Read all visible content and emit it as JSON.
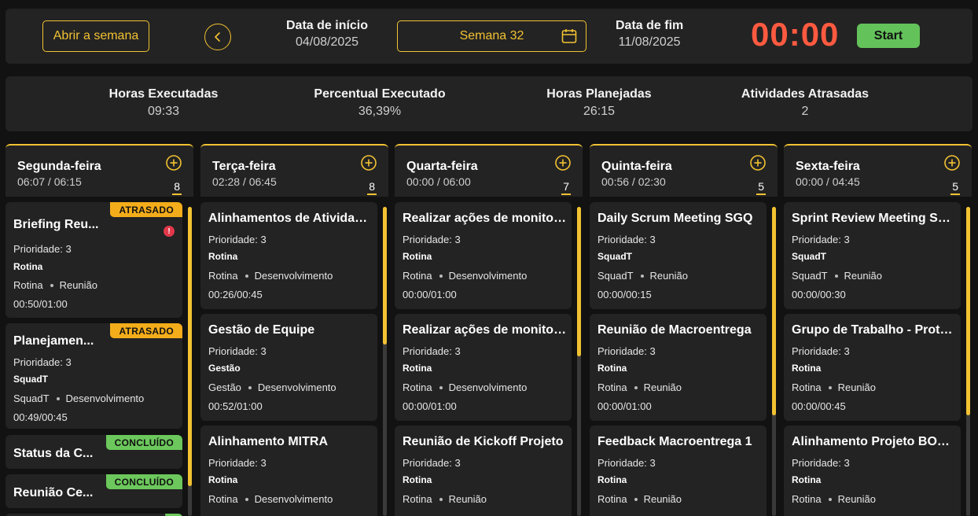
{
  "header": {
    "open_week_label": "Abrir a semana",
    "start_date_label": "Data de início",
    "start_date_value": "04/08/2025",
    "week_label": "Semana 32",
    "end_date_label": "Data de fim",
    "end_date_value": "11/08/2025",
    "timer": "00:00",
    "start_button": "Start",
    "accent_color": "#f2c232",
    "timer_color": "#ff5a40"
  },
  "summary": {
    "executed_hours_label": "Horas Executadas",
    "executed_hours_value": "09:33",
    "percent_label": "Percentual Executado",
    "percent_value": "36,39%",
    "planned_label": "Horas Planejadas",
    "planned_value": "26:15",
    "late_label": "Atividades Atrasadas",
    "late_value": "2"
  },
  "columns": [
    {
      "day": "Segunda-feira",
      "hours": "06:07 / 06:15",
      "count": "8",
      "cards": [
        {
          "title": "Briefing Reu...",
          "badge": "ATRASADO",
          "priority": "Prioridade: 3",
          "group": "Rotina",
          "tag1": "Rotina",
          "tag2": "Reunião",
          "time": "00:50/01:00",
          "alert": "!"
        },
        {
          "title": "Planejamen...",
          "badge": "ATRASADO",
          "priority": "Prioridade: 3",
          "group": "SquadT",
          "tag1": "SquadT",
          "tag2": "Desenvolvimento",
          "time": "00:49/00:45"
        },
        {
          "title": "Status da C...",
          "badge": "CONCLUÍDO"
        },
        {
          "title": "Reunião Ce...",
          "badge": "CONCLUÍDO"
        }
      ]
    },
    {
      "day": "Terça-feira",
      "hours": "02:28 / 06:45",
      "count": "8",
      "cards": [
        {
          "title": "Alinhamentos de Atividades",
          "priority": "Prioridade: 3",
          "group": "Rotina",
          "tag1": "Rotina",
          "tag2": "Desenvolvimento",
          "time": "00:26/00:45"
        },
        {
          "title": "Gestão de Equipe",
          "priority": "Prioridade: 3",
          "group": "Gestão",
          "tag1": "Gestão",
          "tag2": "Desenvolvimento",
          "time": "00:52/01:00"
        },
        {
          "title": "Alinhamento MITRA",
          "priority": "Prioridade: 3",
          "group": "Rotina",
          "tag1": "Rotina",
          "tag2": "Desenvolvimento"
        }
      ]
    },
    {
      "day": "Quarta-feira",
      "hours": "00:00 / 06:00",
      "count": "7",
      "cards": [
        {
          "title": "Realizar ações de monitoramento",
          "priority": "Prioridade: 3",
          "group": "Rotina",
          "tag1": "Rotina",
          "tag2": "Desenvolvimento",
          "time": "00:00/01:00"
        },
        {
          "title": "Realizar ações de monitoramento",
          "priority": "Prioridade: 3",
          "group": "Rotina",
          "tag1": "Rotina",
          "tag2": "Desenvolvimento",
          "time": "00:00/01:00"
        },
        {
          "title": "Reunião de Kickoff Projeto",
          "priority": "Prioridade: 3",
          "group": "Rotina",
          "tag1": "Rotina",
          "tag2": "Reunião"
        }
      ]
    },
    {
      "day": "Quinta-feira",
      "hours": "00:56 / 02:30",
      "count": "5",
      "cards": [
        {
          "title": "Daily Scrum Meeting SGQ",
          "priority": "Prioridade: 3",
          "group": "SquadT",
          "tag1": "SquadT",
          "tag2": "Reunião",
          "time": "00:00/00:15"
        },
        {
          "title": "Reunião de Macroentrega",
          "priority": "Prioridade: 3",
          "group": "Rotina",
          "tag1": "Rotina",
          "tag2": "Reunião",
          "time": "00:00/01:00"
        },
        {
          "title": "Feedback Macroentrega 1",
          "priority": "Prioridade: 3",
          "group": "Rotina",
          "tag1": "Rotina",
          "tag2": "Reunião"
        }
      ]
    },
    {
      "day": "Sexta-feira",
      "hours": "00:00 / 04:45",
      "count": "5",
      "cards": [
        {
          "title": "Sprint Review Meeting SGQ",
          "priority": "Prioridade: 3",
          "group": "SquadT",
          "tag1": "SquadT",
          "tag2": "Reunião",
          "time": "00:00/00:30"
        },
        {
          "title": "Grupo de Trabalho - Protocolo",
          "priority": "Prioridade: 3",
          "group": "Rotina",
          "tag1": "Rotina",
          "tag2": "Reunião",
          "time": "00:00/00:45"
        },
        {
          "title": "Alinhamento Projeto BOWIE",
          "priority": "Prioridade: 3",
          "group": "Rotina",
          "tag1": "Rotina",
          "tag2": "Reunião"
        }
      ]
    }
  ]
}
